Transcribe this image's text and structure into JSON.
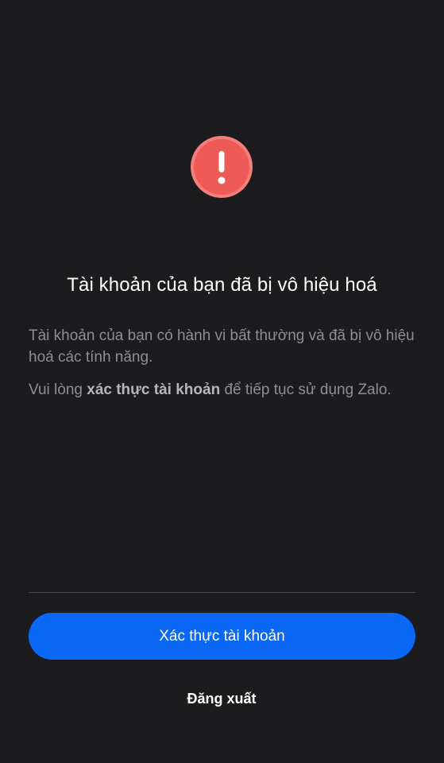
{
  "icon": {
    "name": "exclamation-icon",
    "color": "#ee5a55",
    "ring_color": "#f27f7b"
  },
  "title": "Tài khoản của bạn đã bị vô hiệu hoá",
  "description": {
    "line1": "Tài khoản của bạn có hành vi bất thường và đã bị vô hiệu hoá các tính năng.",
    "line2_prefix": "Vui lòng ",
    "line2_bold": "xác thực tài khoản",
    "line2_suffix": " để tiếp tục sử dụng Zalo."
  },
  "actions": {
    "verify_label": "Xác thực tài khoản",
    "logout_label": "Đăng xuất"
  },
  "colors": {
    "background": "#1c1c1e",
    "primary": "#0a68f5",
    "muted_text": "#8e8e93"
  }
}
